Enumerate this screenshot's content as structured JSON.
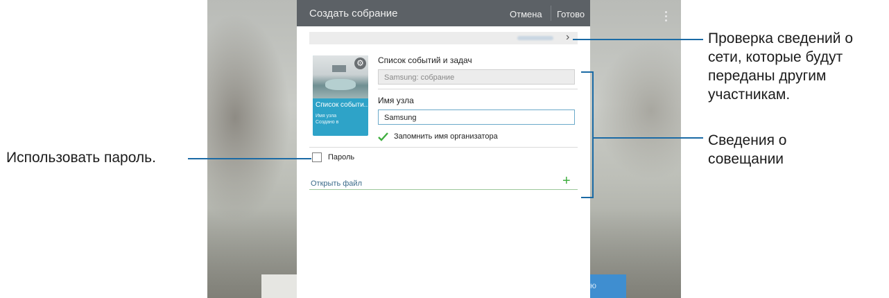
{
  "dialog": {
    "title": "Создать собрание",
    "cancel_label": "Отмена",
    "done_label": "Готово"
  },
  "thumbnail": {
    "caption": "Список событи...",
    "host_line": "Имя узла",
    "created_line": "Создано в"
  },
  "form": {
    "events_label": "Список событий и задач",
    "events_value": "Samsung: собрание",
    "host_label": "Имя узла",
    "host_value": "Samsung",
    "remember_label": "Запомнить имя организатора",
    "remember_checked": true,
    "password_label": "Пароль",
    "password_checked": false,
    "open_file_label": "Открыть файл"
  },
  "background": {
    "right_button_partial": "ю"
  },
  "annotations": {
    "network_info": [
      "Проверка сведений о",
      "сети, которые будут",
      "переданы другим",
      "участникам."
    ],
    "meeting_info": [
      "Сведения о",
      "совещании"
    ],
    "use_password": "Использовать пароль."
  },
  "colors": {
    "titlebar": "#5c6166",
    "accent_check": "#3fae3f",
    "callout_line": "#1a6aa5"
  }
}
